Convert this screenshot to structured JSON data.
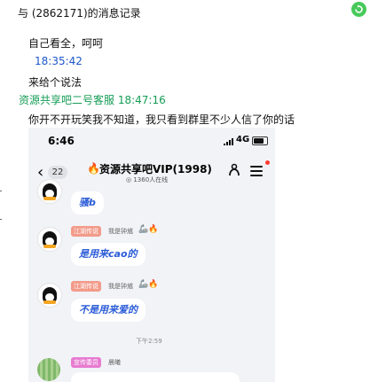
{
  "window": {
    "title": "与   (2862171)的消息记录"
  },
  "colors": {
    "timestamp": "#1c57c9",
    "sender": "#159d56",
    "close_button": "#47c95a",
    "bubble_text": "#2a5bd7"
  },
  "messages": [
    {
      "type": "text",
      "text": "自己看全，呵呵"
    },
    {
      "type": "timestamp",
      "text": "18:35:42"
    },
    {
      "type": "text",
      "text": "来给个说法"
    },
    {
      "type": "sender",
      "text": "资源共享吧二号客服 18:47:16"
    },
    {
      "type": "text",
      "text": "你开不开玩笑我不知道，我只看到群里不少人信了你的话"
    }
  ],
  "phone": {
    "status_time": "6:46",
    "network": "4G",
    "back_count": "22",
    "group_name": "资源共享吧VIP(1998)",
    "online": "1360人在线",
    "time_divider": "下午2:59",
    "chat": [
      {
        "bubble": "骚b"
      },
      {
        "tag": "江湖传说",
        "nick": "我是钟馗",
        "bubble": "是用来cao的"
      },
      {
        "tag": "江湖传说",
        "nick": "我是钟馗",
        "bubble": "不是用来爱的"
      },
      {
        "tag": "宣传委员",
        "nick": "晨曦"
      }
    ],
    "tag_colors": {
      "jianghu": "#f29b8a",
      "xuanchuan": "#e77bd1"
    }
  },
  "icons": {
    "close": "close-icon",
    "back": "chevron-left-icon",
    "fire": "fire-icon",
    "team": "team-icon",
    "menu": "menu-icon",
    "signal": "signal-icon",
    "battery": "battery-icon",
    "avatar": "penguin-avatar-icon"
  }
}
